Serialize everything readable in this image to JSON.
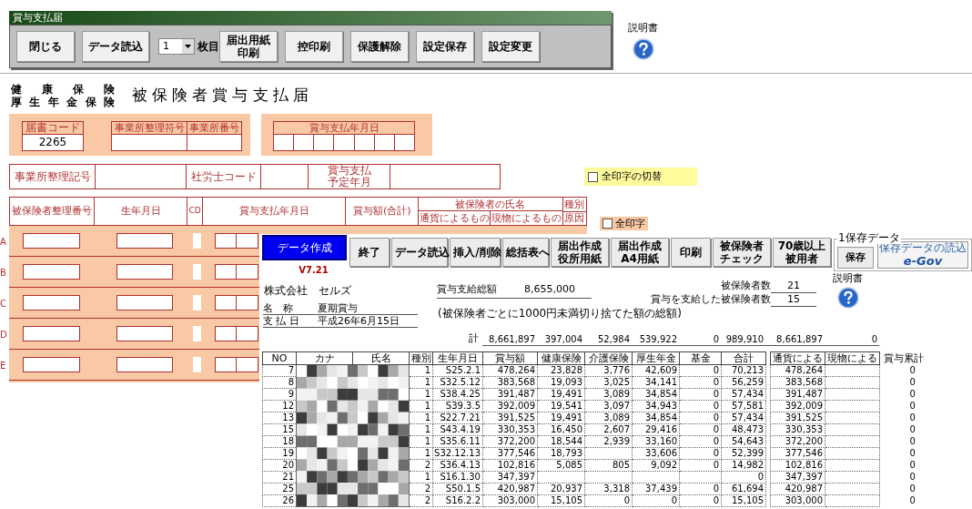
{
  "app_window": {
    "title": "賞与支払届",
    "toolbar": [
      {
        "kind": "button",
        "label": "閉じる"
      },
      {
        "kind": "button",
        "label": "データ読込"
      },
      {
        "kind": "select",
        "value": "1"
      },
      {
        "kind": "label",
        "label": "枚目"
      },
      {
        "kind": "button",
        "label": "届出用紙印刷"
      },
      {
        "kind": "button",
        "label": "控印刷"
      },
      {
        "kind": "button",
        "label": "保護解除"
      },
      {
        "kind": "button",
        "label": "設定保存"
      },
      {
        "kind": "button",
        "label": "設定変更"
      }
    ],
    "help_label": "説明書"
  },
  "form": {
    "heading_lines": [
      "健康保険",
      "厚生年金保険"
    ],
    "title": "被保険者賞与支払届",
    "code": {
      "label": "届書コード",
      "value": "2265"
    },
    "office_fields": [
      "事業所整理符号",
      "事業所番号"
    ],
    "pay_date_label": "賞与支払年月日",
    "info_labels": [
      "事業所整理記号",
      "社労士コード",
      "賞与支払予定年月"
    ],
    "print_all_toggle": {
      "label": "全印字の切替",
      "checked": false
    },
    "columns": [
      "被保険者整理番号",
      "生年月日",
      "CD",
      "賞与支払年月日",
      "賞与額(合計)"
    ],
    "name_header": {
      "label": "被保険者の氏名",
      "sub": [
        "通貨によるもの",
        "現物によるもの"
      ]
    },
    "kind_header": [
      "種別",
      "原因"
    ],
    "print_all": {
      "label": "全印字",
      "checked": false
    },
    "row_letters": [
      "A",
      "B",
      "C",
      "D",
      "E"
    ]
  },
  "data_window": {
    "primary_button": "データ作成",
    "version": "V7.21",
    "buttons": [
      "終了",
      "データ読込",
      "挿入/削除",
      "総括表へ",
      "届出作成役所用紙",
      "届出作成A4用紙",
      "印刷",
      "被保険者チェック",
      "70歳以上被用者"
    ],
    "save_group": {
      "legend": "1保存データ",
      "save_button": "保存",
      "egov_caption": "保存データの読込",
      "egov_button": "e-Gov"
    },
    "company": "株式会社　セルズ",
    "total_label": "賞与支給総額",
    "total_value": "8,655,000",
    "total_note": "(被保険者ごとに1000円未満切り捨てた額の総額)",
    "insured_label": "被保険者数",
    "insured_value": "21",
    "paid_label": "賞与を支給した被保険者数",
    "paid_value": "15",
    "help_label": "説明書",
    "name_label": "名　称",
    "name_value": "夏期賞与",
    "date_label": "支 払 日",
    "date_value": "平成26年6月15日",
    "sum_label": "計",
    "sums": [
      "8,661,897",
      "397,004",
      "52,984",
      "539,922",
      "0",
      "989,910",
      "8,661,897",
      "0"
    ],
    "columns": [
      "NO",
      "カナ",
      "氏名",
      "種別",
      "生年月日",
      "賞与額",
      "健康保険",
      "介護保険",
      "厚生年金",
      "基金",
      "合計",
      "通貨による",
      "現物による",
      "賞与累計"
    ],
    "rows": [
      {
        "no": "7",
        "type": "1",
        "birth": "S25.2.1",
        "bonus": "478,264",
        "health": "23,828",
        "care": "3,776",
        "pension": "42,609",
        "fund": "0",
        "total": "70,213",
        "cash": "478,264",
        "cumulative": "0"
      },
      {
        "no": "8",
        "type": "1",
        "birth": "S32.5.12",
        "bonus": "383,568",
        "health": "19,093",
        "care": "3,025",
        "pension": "34,141",
        "fund": "0",
        "total": "56,259",
        "cash": "383,568",
        "cumulative": "0"
      },
      {
        "no": "9",
        "type": "1",
        "birth": "S38.4.25",
        "bonus": "391,487",
        "health": "19,491",
        "care": "3,089",
        "pension": "34,854",
        "fund": "0",
        "total": "57,434",
        "cash": "391,487",
        "cumulative": "0"
      },
      {
        "no": "12",
        "type": "1",
        "birth": "S39.3.5",
        "bonus": "392,009",
        "health": "19,541",
        "care": "3,097",
        "pension": "34,943",
        "fund": "0",
        "total": "57,581",
        "cash": "392,009",
        "cumulative": "0"
      },
      {
        "no": "13",
        "type": "1",
        "birth": "S22.7.21",
        "bonus": "391,525",
        "health": "19,491",
        "care": "3,089",
        "pension": "34,854",
        "fund": "0",
        "total": "57,434",
        "cash": "391,525",
        "cumulative": "0"
      },
      {
        "no": "15",
        "type": "1",
        "birth": "S43.4.19",
        "bonus": "330,353",
        "health": "16,450",
        "care": "2,607",
        "pension": "29,416",
        "fund": "0",
        "total": "48,473",
        "cash": "330,353",
        "cumulative": "0"
      },
      {
        "no": "18",
        "type": "1",
        "birth": "S35.6.11",
        "bonus": "372,200",
        "health": "18,544",
        "care": "2,939",
        "pension": "33,160",
        "fund": "0",
        "total": "54,643",
        "cash": "372,200",
        "cumulative": "0"
      },
      {
        "no": "19",
        "type": "1",
        "birth": "S32.12.13",
        "bonus": "377,546",
        "health": "18,793",
        "pension": "33,606",
        "fund": "0",
        "total": "52,399",
        "cash": "377,546",
        "cumulative": "0"
      },
      {
        "no": "20",
        "type": "2",
        "birth": "S36.4.13",
        "bonus": "102,816",
        "health": "5,085",
        "care": "805",
        "pension": "9,092",
        "fund": "0",
        "total": "14,982",
        "cash": "102,816",
        "cumulative": "0"
      },
      {
        "no": "21",
        "type": "1",
        "birth": "S16.1.30",
        "bonus": "347,397",
        "total": "0",
        "cash": "347,397",
        "cumulative": "0"
      },
      {
        "no": "25",
        "type": "2",
        "birth": "S50.1.5",
        "bonus": "420,987",
        "health": "20,937",
        "care": "3,318",
        "pension": "37,439",
        "fund": "0",
        "total": "61,694",
        "cash": "420,987",
        "cumulative": "0"
      },
      {
        "no": "26",
        "type": "2",
        "birth": "S16.2.2",
        "bonus": "303,000",
        "health": "15,105",
        "care": "0",
        "pension": "0",
        "fund": "0",
        "total": "15,105",
        "cash": "303,000",
        "cumulative": "0"
      }
    ]
  }
}
